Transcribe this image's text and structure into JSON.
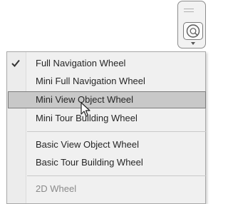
{
  "widget": {
    "icon": "navigation-wheel-icon",
    "dropdown_icon": "chevron-down-icon"
  },
  "menu": {
    "items": [
      {
        "label": "Full Navigation Wheel",
        "checked": true
      },
      {
        "label": "Mini Full Navigation Wheel"
      },
      {
        "label": "Mini View Object Wheel",
        "highlighted": true
      },
      {
        "label": "Mini Tour Building Wheel"
      },
      {
        "label": "Basic View Object Wheel"
      },
      {
        "label": "Basic Tour Building Wheel"
      },
      {
        "label": "2D Wheel",
        "disabled": true
      }
    ]
  },
  "colors": {
    "menu_bg": "#f0f0f0",
    "highlight_bg": "#c8c8c8",
    "highlight_border": "#7d7d7d",
    "text": "#262626",
    "disabled_text": "#8a8a8a"
  }
}
